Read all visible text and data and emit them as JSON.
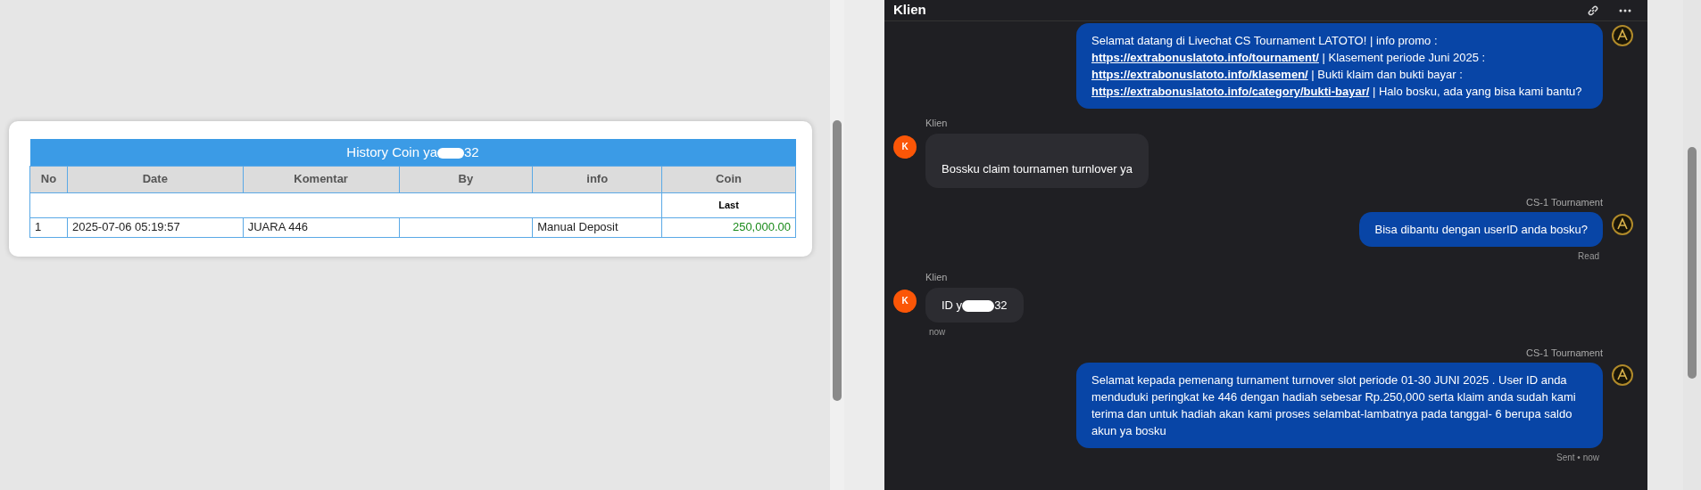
{
  "history": {
    "title_parts": [
      "History Coin ya",
      "32"
    ],
    "columns": [
      "No",
      "Date",
      "Komentar",
      "By",
      "info",
      "Coin"
    ],
    "subheader": "Last",
    "rows": [
      {
        "cells": [
          "1",
          "2025-07-06 05:19:57",
          "JUARA 446",
          "",
          "Manual Deposit",
          "250,000.00"
        ]
      }
    ]
  },
  "chat": {
    "header": {
      "title": "Klien"
    },
    "messages": [
      {
        "kind": "agent",
        "segments": [
          {
            "kind": "text",
            "text": "Selamat datang di Livechat CS Tournament LATOTO! | info promo : "
          },
          {
            "kind": "link",
            "text": "https://extrabonuslatoto.info/tournament/"
          },
          {
            "kind": "text",
            "text": " | Klasement periode Juni 2025 : "
          },
          {
            "kind": "link",
            "text": "https://extrabonuslatoto.info/klasemen/"
          },
          {
            "kind": "text",
            "text": " | Bukti klaim dan bukti bayar : "
          },
          {
            "kind": "link",
            "text": "https://extrabonuslatoto.info/category/bukti-bayar/"
          },
          {
            "kind": "text",
            "text": " | Halo bosku, ada yang bisa kami bantu?"
          }
        ]
      },
      {
        "kind": "client",
        "sender": "Klien",
        "avatar": "K",
        "segments": [
          {
            "kind": "text",
            "text": "Bossku claim tournamen turnlover ya"
          }
        ]
      },
      {
        "kind": "agent",
        "sender": "CS-1 Tournament",
        "segments": [
          {
            "kind": "text",
            "text": "Bisa dibantu dengan userID anda bosku?"
          }
        ],
        "status": "Read"
      },
      {
        "kind": "client",
        "sender": "Klien",
        "avatar": "K",
        "segments": [
          {
            "kind": "text",
            "text": "ID y"
          },
          {
            "kind": "redacted"
          },
          {
            "kind": "text",
            "text": "32"
          }
        ],
        "status": "now"
      },
      {
        "kind": "agent",
        "sender": "CS-1 Tournament",
        "segments": [
          {
            "kind": "text",
            "text": "Selamat kepada pemenang turnament turnover slot periode 01-30 JUNI 2025 . User ID anda menduduki peringkat ke 446 dengan hadiah sebesar Rp.250,000 serta klaim anda sudah kami terima dan untuk hadiah akan kami proses selambat-lambatnya pada tanggal- 6 berupa saldo akun ya bosku"
          }
        ],
        "status": "Sent • now"
      }
    ]
  }
}
